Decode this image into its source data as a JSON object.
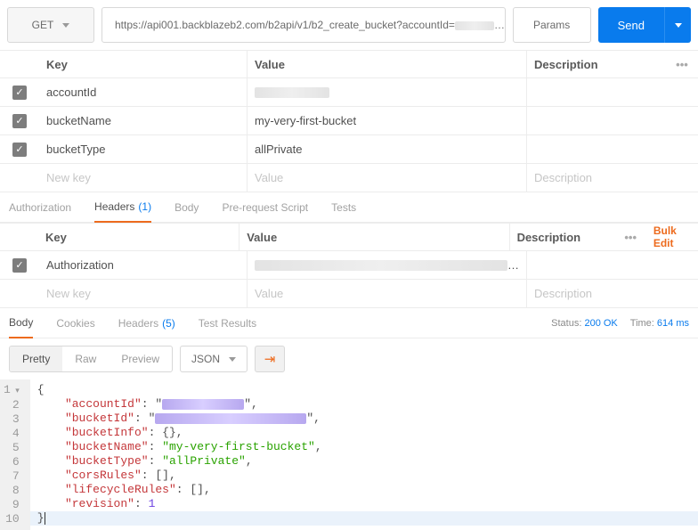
{
  "request": {
    "method": "GET",
    "url_prefix": "https://api001.backblazeb2.com/b2api/v1/b2_create_bucket?accountId=",
    "url_suffix": "…",
    "params_btn": "Params",
    "send_btn": "Send"
  },
  "params_table": {
    "headers": {
      "key": "Key",
      "value": "Value",
      "description": "Description"
    },
    "rows": [
      {
        "key": "accountId",
        "value_redacted": true
      },
      {
        "key": "bucketName",
        "value": "my-very-first-bucket"
      },
      {
        "key": "bucketType",
        "value": "allPrivate"
      }
    ],
    "placeholder": {
      "key": "New key",
      "value": "Value",
      "description": "Description"
    }
  },
  "req_tabs": {
    "items": [
      "Authorization",
      "Headers",
      "Body",
      "Pre-request Script",
      "Tests"
    ],
    "active": 1,
    "headers_count": "(1)"
  },
  "headers_table": {
    "headers": {
      "key": "Key",
      "value": "Value",
      "description": "Description"
    },
    "bulk_edit": "Bulk Edit",
    "rows": [
      {
        "key": "Authorization",
        "value_redacted": true,
        "value_suffix": "…"
      }
    ],
    "placeholder": {
      "key": "New key",
      "value": "Value",
      "description": "Description"
    }
  },
  "resp_tabs": {
    "items": [
      "Body",
      "Cookies",
      "Headers",
      "Test Results"
    ],
    "active": 0,
    "headers_count": "(5)",
    "status_label": "Status:",
    "status_value": "200 OK",
    "time_label": "Time:",
    "time_value": "614 ms"
  },
  "body_view": {
    "modes": [
      "Pretty",
      "Raw",
      "Preview"
    ],
    "active_mode": 0,
    "format": "JSON"
  },
  "response_json": {
    "lines": [
      {
        "n": 1,
        "indent": 0,
        "open": "{"
      },
      {
        "n": 2,
        "indent": 2,
        "key": "accountId",
        "redacted": "purple",
        "w": 92,
        "comma": true
      },
      {
        "n": 3,
        "indent": 2,
        "key": "bucketId",
        "redacted": "purple",
        "w": 170,
        "comma": true
      },
      {
        "n": 4,
        "indent": 2,
        "key": "bucketInfo",
        "raw": "{}",
        "comma": true
      },
      {
        "n": 5,
        "indent": 2,
        "key": "bucketName",
        "str": "my-very-first-bucket",
        "comma": true
      },
      {
        "n": 6,
        "indent": 2,
        "key": "bucketType",
        "str": "allPrivate",
        "comma": true
      },
      {
        "n": 7,
        "indent": 2,
        "key": "corsRules",
        "raw": "[]",
        "comma": true
      },
      {
        "n": 8,
        "indent": 2,
        "key": "lifecycleRules",
        "raw": "[]",
        "comma": true
      },
      {
        "n": 9,
        "indent": 2,
        "key": "revision",
        "num": 1
      },
      {
        "n": 10,
        "indent": 0,
        "close": "}"
      }
    ]
  }
}
